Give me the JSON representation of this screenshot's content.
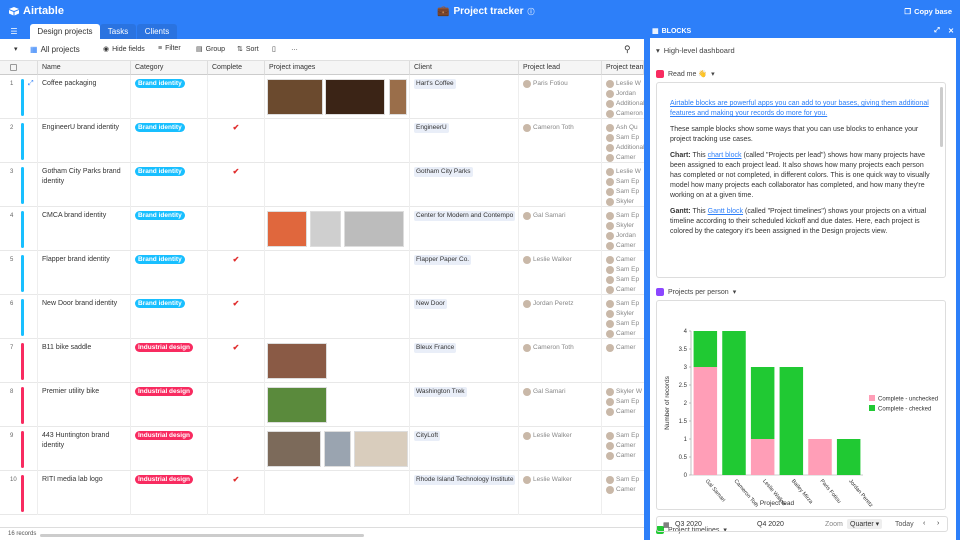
{
  "app": {
    "logo_text": "Airtable",
    "title": "Project tracker",
    "copy_base": "Copy base"
  },
  "tabs": [
    {
      "label": "Design projects"
    },
    {
      "label": "Tasks"
    },
    {
      "label": "Clients"
    }
  ],
  "toolbar": {
    "view_name": "All projects",
    "hide_fields": "Hide fields",
    "filter": "Filter",
    "group": "Group",
    "sort": "Sort",
    "more": "…"
  },
  "columns": {
    "name": "Name",
    "category": "Category",
    "complete": "Complete",
    "images": "Project images",
    "client": "Client",
    "lead": "Project lead",
    "team": "Project team"
  },
  "colors": {
    "brand": "#2d7ff9",
    "brand_identity": "#18bfff",
    "industrial_design": "#f82b60",
    "check": "#e02c2c",
    "chart_pink": "#ff9eb7",
    "chart_green": "#20c933"
  },
  "rows": [
    {
      "num": "1",
      "name": "Coffee packaging",
      "category": "Brand identity",
      "complete": "",
      "client": "Hart's Coffee",
      "lead": "Paris Fotiou",
      "team": [
        "Leslie W",
        "Jordan",
        "Additional",
        "Cameron"
      ]
    },
    {
      "num": "2",
      "name": "EngineerU brand identity",
      "category": "Brand identity",
      "complete": "✔",
      "client": "EngineerU",
      "lead": "Cameron Toth",
      "team": [
        "Ash Qu",
        "Sam Ep",
        "Additional",
        "Camer"
      ]
    },
    {
      "num": "3",
      "name": "Gotham City Parks brand identity",
      "category": "Brand identity",
      "complete": "✔",
      "client": "Gotham City Parks",
      "lead": "",
      "team": [
        "Leslie W",
        "Sam Ep",
        "Sam Ep",
        "Skyler"
      ]
    },
    {
      "num": "4",
      "name": "CMCA brand identity",
      "category": "Brand identity",
      "complete": "",
      "client": "Center for Modern and Contempo",
      "lead": "Gal Samari",
      "team": [
        "Sam Ep",
        "Skyler",
        "Jordan",
        "Camer"
      ]
    },
    {
      "num": "5",
      "name": "Flapper brand identity",
      "category": "Brand identity",
      "complete": "✔",
      "client": "Flapper Paper Co.",
      "lead": "Leslie Walker",
      "team": [
        "Camer",
        "Sam Ep",
        "Sam Ep",
        "Camer"
      ]
    },
    {
      "num": "6",
      "name": "New Door brand identity",
      "category": "Brand identity",
      "complete": "✔",
      "client": "New Door",
      "lead": "Jordan Peretz",
      "team": [
        "Sam Ep",
        "Skyler",
        "Sam Ep",
        "Camer"
      ]
    },
    {
      "num": "7",
      "name": "B11 bike saddle",
      "category": "Industrial design",
      "complete": "✔",
      "client": "Bleux France",
      "lead": "Cameron Toth",
      "team": [
        "Camer"
      ]
    },
    {
      "num": "8",
      "name": "Premier utility bike",
      "category": "Industrial design",
      "complete": "",
      "client": "Washington Trek",
      "lead": "Gal Samari",
      "team": [
        "Skyler W",
        "Sam Ep",
        "Camer"
      ]
    },
    {
      "num": "9",
      "name": "443 Huntington brand identity",
      "category": "Industrial design",
      "complete": "",
      "client": "CityLoft",
      "lead": "Leslie Walker",
      "team": [
        "Sam Ep",
        "Camer",
        "Camer"
      ]
    },
    {
      "num": "10",
      "name": "RITI media lab logo",
      "category": "Industrial design",
      "complete": "✔",
      "client": "Rhode Island Technology Institute",
      "lead": "Leslie Walker",
      "team": [
        "Sam Ep",
        "Camer"
      ]
    }
  ],
  "footer": {
    "records": "16 records"
  },
  "blocks": {
    "header": "BLOCKS",
    "dashboard": "High-level dashboard",
    "readme_title": "Read me 👋",
    "readme_link": "Airtable blocks are powerful apps you can add to your bases, giving them additional features and making your records do more for you.",
    "readme_p1": "These sample blocks show some ways that you can use blocks to enhance your project tracking use cases.",
    "chart_label": "Chart:",
    "chart_this": "This",
    "chart_link": "chart block",
    "chart_rest": "(called \"Projects per lead\") shows how many projects have been assigned to each project lead. It also shows how many projects each person has completed or not completed, in different colors. This is one quick way to visually model how many projects each collaborator has completed, and how many they're working on at a given time.",
    "gantt_label": "Gantt:",
    "gantt_this": "This",
    "gantt_link": "Gantt block",
    "gantt_rest": "(called \"Project timelines\") shows your projects on a virtual timeline according to their scheduled kickoff and due dates. Here, each project is colored by the category it's been assigned in the Design projects view.",
    "chart_title": "Projects per person",
    "gantt_title": "Project timelines",
    "gantt_q1": "Q3 2020",
    "gantt_q2": "Q4 2020",
    "zoom": "Zoom",
    "zoom_value": "Quarter",
    "today": "Today"
  },
  "chart_data": {
    "type": "bar",
    "categories": [
      "Gal Samari",
      "Cameron Toth",
      "Leslie Walker",
      "Bailey Mirza",
      "Paris Fotiou",
      "Jordan Peretz"
    ],
    "series": [
      {
        "name": "Complete - unchecked",
        "values": [
          3,
          0,
          1,
          0,
          1,
          0
        ]
      },
      {
        "name": "Complete - checked",
        "values": [
          1,
          4,
          2,
          3,
          0,
          1
        ]
      }
    ],
    "stacked": true,
    "xlabel": "Project lead",
    "ylabel": "Number of records",
    "ylim": [
      0,
      4
    ],
    "yticks": [
      "0",
      "0.5",
      "1",
      "1.5",
      "2",
      "2.5",
      "3",
      "3.5",
      "4"
    ],
    "legend": "right"
  }
}
